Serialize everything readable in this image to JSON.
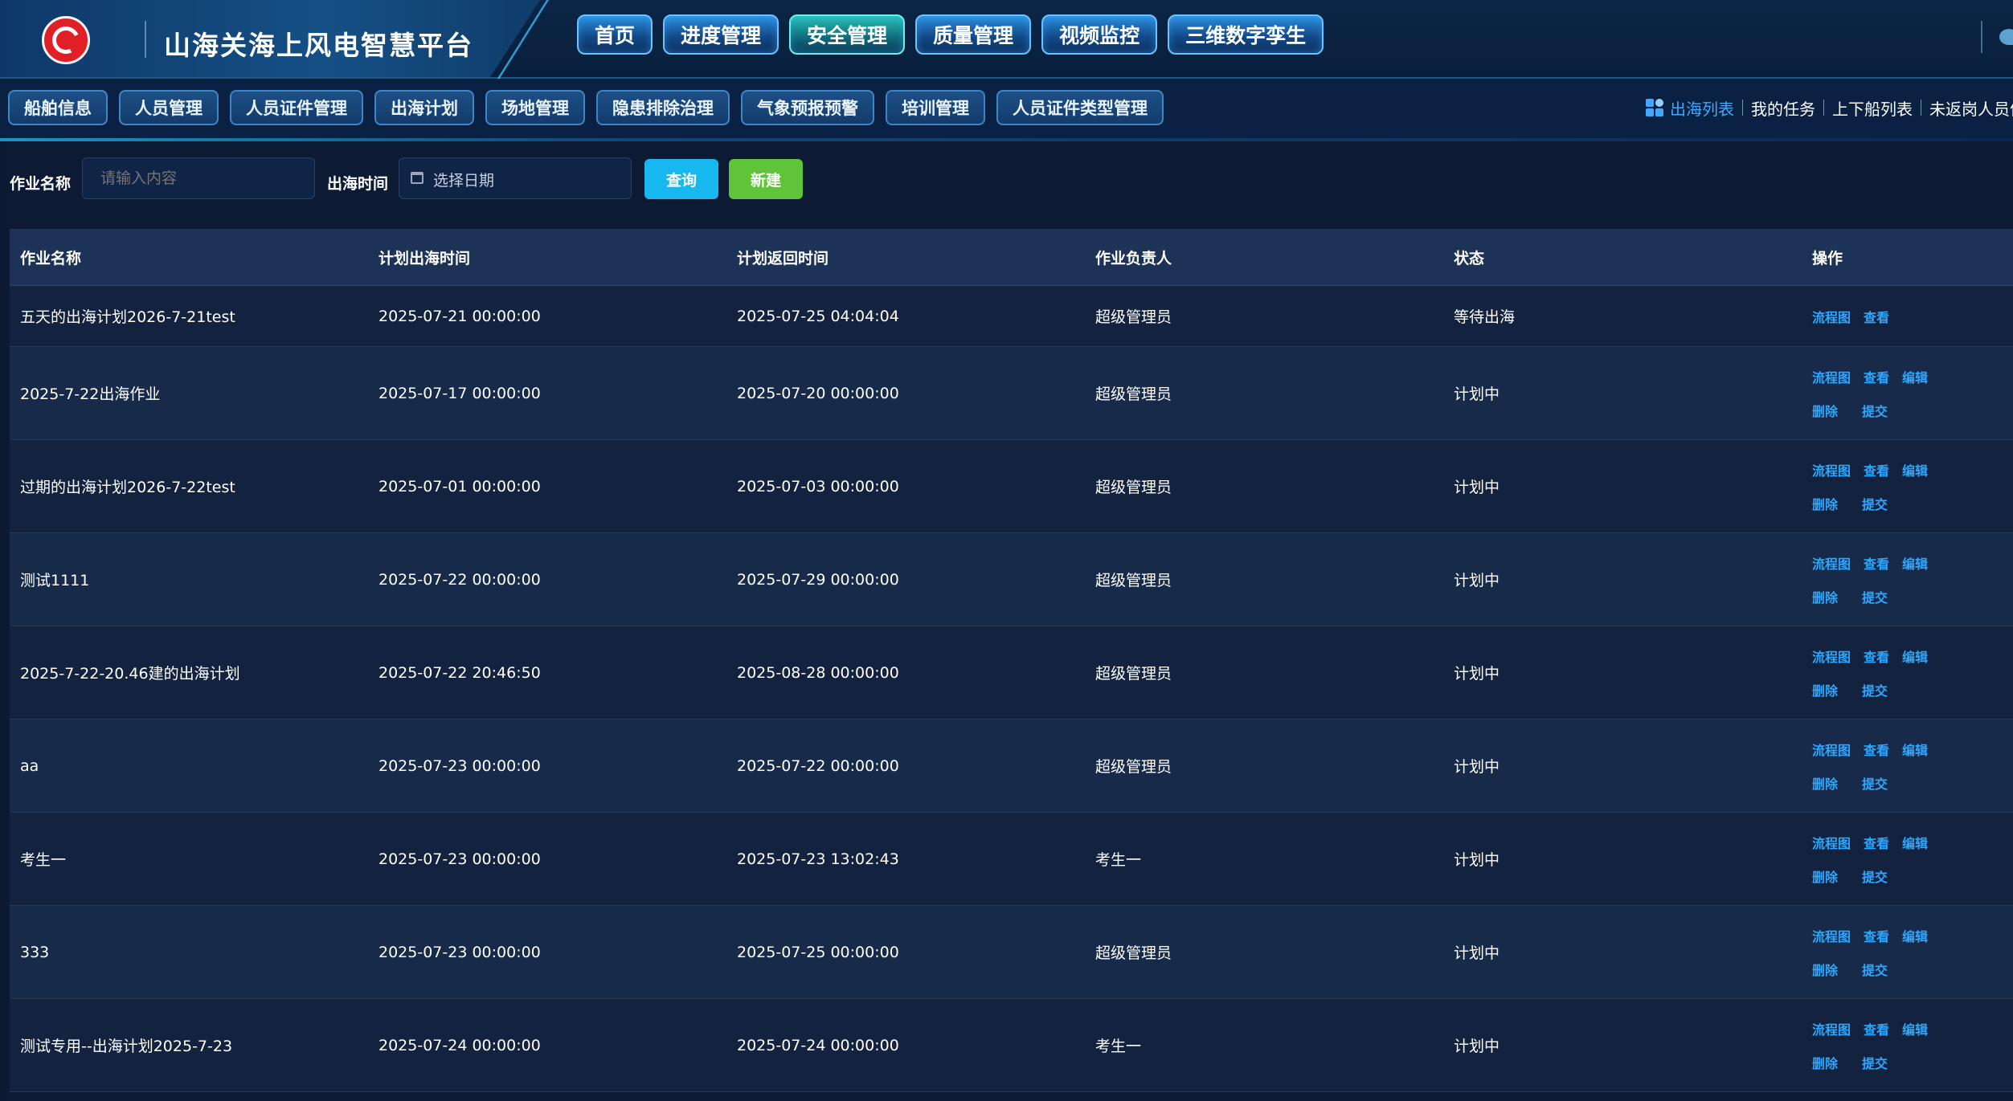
{
  "header": {
    "title": "山海关海上风电智慧平台",
    "logo_icon": "logo-icon",
    "nav": [
      {
        "label": "首页",
        "active": false
      },
      {
        "label": "进度管理",
        "active": false
      },
      {
        "label": "安全管理",
        "active": true
      },
      {
        "label": "质量管理",
        "active": false
      },
      {
        "label": "视频监控",
        "active": false
      },
      {
        "label": "三维数字孪生",
        "active": false
      }
    ]
  },
  "subnav": {
    "tabs": [
      "船舶信息",
      "人员管理",
      "人员证件管理",
      "出海计划",
      "场地管理",
      "隐患排除治理",
      "气象预报预警",
      "培训管理",
      "人员证件类型管理"
    ],
    "links": [
      {
        "label": "出海列表",
        "active": true
      },
      {
        "label": "我的任务",
        "active": false
      },
      {
        "label": "上下船列表",
        "active": false
      },
      {
        "label": "未返岗人员信息",
        "active": false
      }
    ]
  },
  "filters": {
    "name_label": "作业名称",
    "name_placeholder": "请输入内容",
    "date_label": "出海时间",
    "date_placeholder": "选择日期",
    "query_label": "查询",
    "new_label": "新建"
  },
  "table": {
    "columns": [
      "作业名称",
      "计划出海时间",
      "计划返回时间",
      "作业负责人",
      "状态",
      "操作"
    ],
    "rows": [
      {
        "name": "五天的出海计划2026-7-21test",
        "depart": "2025-07-21 00:00:00",
        "return": "2025-07-25 04:04:04",
        "owner": "超级管理员",
        "status": "等待出海",
        "ops": [
          "流程图",
          "查看"
        ]
      },
      {
        "name": "2025-7-22出海作业",
        "depart": "2025-07-17 00:00:00",
        "return": "2025-07-20 00:00:00",
        "owner": "超级管理员",
        "status": "计划中",
        "ops": [
          "流程图",
          "查看",
          "编辑",
          "删除",
          "提交"
        ]
      },
      {
        "name": "过期的出海计划2026-7-22test",
        "depart": "2025-07-01 00:00:00",
        "return": "2025-07-03 00:00:00",
        "owner": "超级管理员",
        "status": "计划中",
        "ops": [
          "流程图",
          "查看",
          "编辑",
          "删除",
          "提交"
        ]
      },
      {
        "name": "测试1111",
        "depart": "2025-07-22 00:00:00",
        "return": "2025-07-29 00:00:00",
        "owner": "超级管理员",
        "status": "计划中",
        "ops": [
          "流程图",
          "查看",
          "编辑",
          "删除",
          "提交"
        ]
      },
      {
        "name": "2025-7-22-20.46建的出海计划",
        "depart": "2025-07-22 20:46:50",
        "return": "2025-08-28 00:00:00",
        "owner": "超级管理员",
        "status": "计划中",
        "ops": [
          "流程图",
          "查看",
          "编辑",
          "删除",
          "提交"
        ]
      },
      {
        "name": "aa",
        "depart": "2025-07-23 00:00:00",
        "return": "2025-07-22 00:00:00",
        "owner": "超级管理员",
        "status": "计划中",
        "ops": [
          "流程图",
          "查看",
          "编辑",
          "删除",
          "提交"
        ]
      },
      {
        "name": "考生一",
        "depart": "2025-07-23 00:00:00",
        "return": "2025-07-23 13:02:43",
        "owner": "考生一",
        "status": "计划中",
        "ops": [
          "流程图",
          "查看",
          "编辑",
          "删除",
          "提交"
        ]
      },
      {
        "name": "333",
        "depart": "2025-07-23 00:00:00",
        "return": "2025-07-25 00:00:00",
        "owner": "超级管理员",
        "status": "计划中",
        "ops": [
          "流程图",
          "查看",
          "编辑",
          "删除",
          "提交"
        ]
      },
      {
        "name": "测试专用--出海计划2025-7-23",
        "depart": "2025-07-24 00:00:00",
        "return": "2025-07-24 00:00:00",
        "owner": "考生一",
        "status": "计划中",
        "ops": [
          "流程图",
          "查看",
          "编辑",
          "删除",
          "提交"
        ]
      }
    ]
  },
  "colors": {
    "background": "#0d1a33",
    "accent": "#2ca8ff",
    "query_button": "#17b7f0",
    "new_button": "#5fc437",
    "active_nav": "#29c4b7"
  }
}
